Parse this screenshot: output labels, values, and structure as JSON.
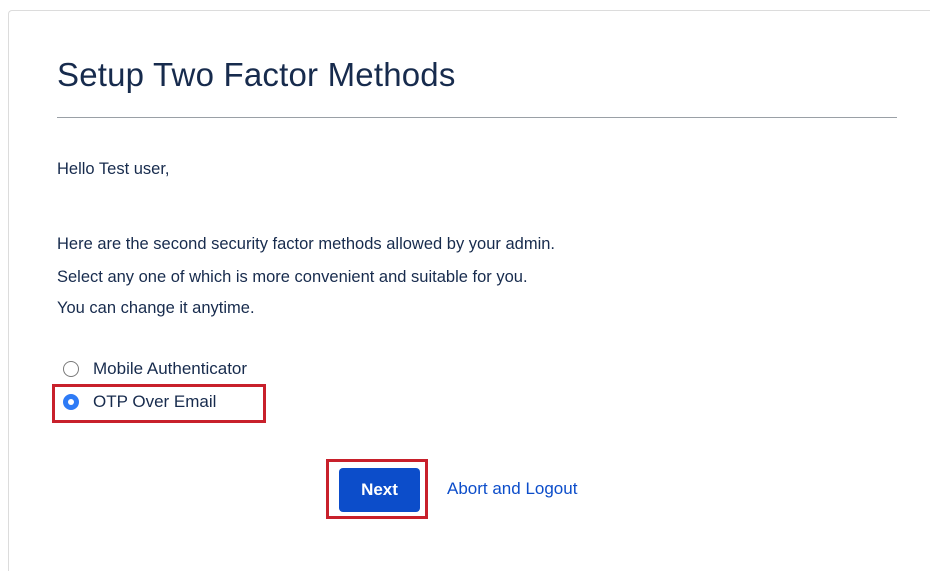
{
  "page": {
    "title": "Setup Two Factor Methods",
    "greeting": "Hello Test user,",
    "info_lines": [
      "Here are the second security factor methods allowed by your admin.",
      "Select any one of which is more convenient and suitable for you.",
      "You can change it anytime."
    ]
  },
  "methods": {
    "options": [
      {
        "label": "Mobile Authenticator",
        "checked": false
      },
      {
        "label": "OTP Over Email",
        "checked": true
      }
    ],
    "selected": "OTP Over Email"
  },
  "actions": {
    "next_label": "Next",
    "abort_label": "Abort and Logout"
  },
  "colors": {
    "primary": "#0c4dca",
    "radio_checked": "#2e7bf6",
    "highlight_border": "#c8202b",
    "text": "#172b4d"
  }
}
